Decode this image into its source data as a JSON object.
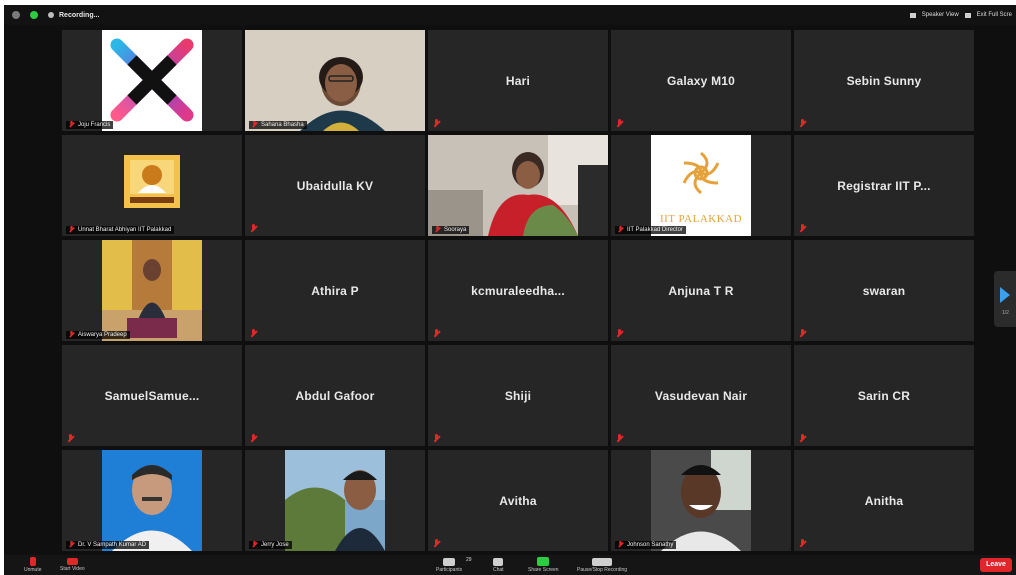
{
  "topbar": {
    "recording_label": "Recording...",
    "speaker_view_label": "Speaker View",
    "exit_fullscreen_label": "Exit Full Scre"
  },
  "tiles": [
    {
      "name": "",
      "label": "Joju Francis",
      "kind": "logo-x"
    },
    {
      "name": "",
      "label": "Sahana Bhasha",
      "kind": "video-woman",
      "active": true
    },
    {
      "name": "Hari",
      "label": ""
    },
    {
      "name": "Galaxy M10",
      "label": ""
    },
    {
      "name": "Sebin Sunny",
      "label": ""
    },
    {
      "name": "",
      "label": "Unnat Bharat Abhiyan IIT Palakkad",
      "kind": "logo-uba"
    },
    {
      "name": "Ubaidulla KV",
      "label": ""
    },
    {
      "name": "",
      "label": "Sooraya",
      "kind": "video-saree"
    },
    {
      "name": "",
      "label": "IIT Palakkad Director",
      "kind": "logo-iit",
      "logo_text": "IIT PALAKKAD"
    },
    {
      "name": "Registrar IIT P...",
      "label": ""
    },
    {
      "name": "",
      "label": "Aiswarya Pradeep",
      "kind": "photo-girl"
    },
    {
      "name": "Athira P",
      "label": ""
    },
    {
      "name": "kcmuraleedha...",
      "label": ""
    },
    {
      "name": "Anjuna T R",
      "label": ""
    },
    {
      "name": "swaran",
      "label": ""
    },
    {
      "name": "SamuelSamue...",
      "label": ""
    },
    {
      "name": "Abdul Gafoor",
      "label": ""
    },
    {
      "name": "Shiji",
      "label": ""
    },
    {
      "name": "Vasudevan Nair",
      "label": ""
    },
    {
      "name": "Sarin CR",
      "label": ""
    },
    {
      "name": "",
      "label": "Dr. V Sampath Kumar AD",
      "kind": "photo-man1"
    },
    {
      "name": "",
      "label": "Jerry Jose",
      "kind": "photo-man2"
    },
    {
      "name": "Avitha",
      "label": ""
    },
    {
      "name": "",
      "label": "Johnson Sanathy",
      "kind": "photo-man3"
    },
    {
      "name": "Anitha",
      "label": ""
    }
  ],
  "pager": {
    "indicator": "1/2"
  },
  "toolbar": {
    "unmute_label": "Unmute",
    "start_video_label": "Start Video",
    "participants_label": "Participants",
    "participants_count": "29",
    "chat_label": "Chat",
    "share_screen_label": "Share Screen",
    "recording_label": "Recording...",
    "pause_recording_label": "Pause/Stop Recording",
    "leave_label": "Leave"
  },
  "colors": {
    "active_speaker": "#c5df3a",
    "leave": "#e0262a",
    "share": "#2ecc40",
    "muted": "#e02828"
  }
}
